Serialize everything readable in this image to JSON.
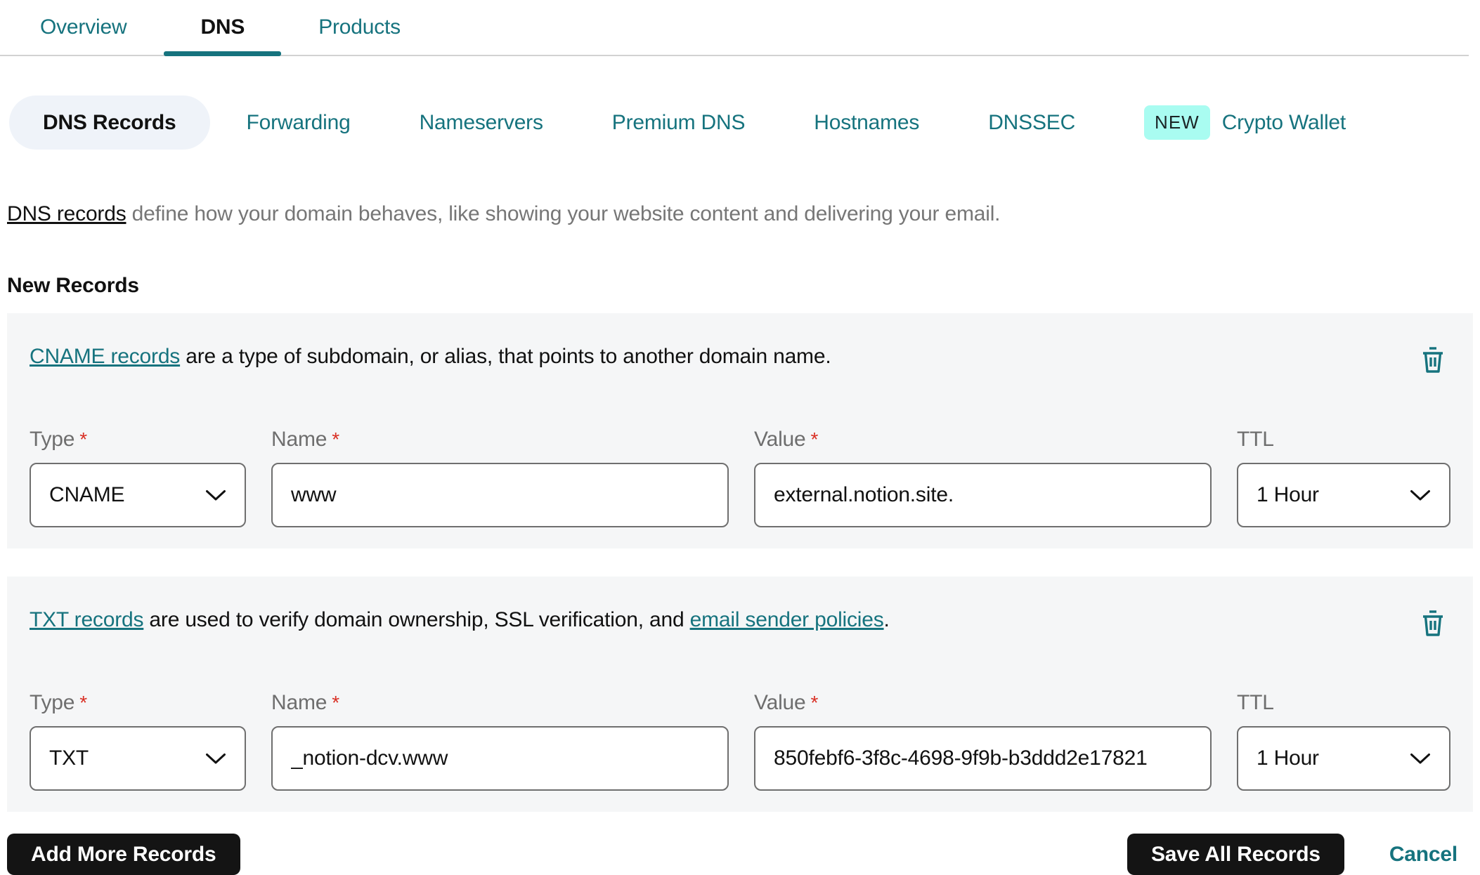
{
  "colors": {
    "teal": "#16737e",
    "badge_bg": "#a9fcf1",
    "card_bg": "#f5f6f7",
    "pill_bg": "#eff3f9",
    "required_red": "#d93025",
    "button_bg": "#141414"
  },
  "tabs": {
    "overview": "Overview",
    "dns": "DNS",
    "products": "Products"
  },
  "subtabs": {
    "dns_records": "DNS Records",
    "forwarding": "Forwarding",
    "nameservers": "Nameservers",
    "premium_dns": "Premium DNS",
    "hostnames": "Hostnames",
    "dnssec": "DNSSEC",
    "new_badge": "NEW",
    "crypto_wallet": "Crypto Wallet"
  },
  "description": {
    "link": "DNS records",
    "text": " define how your domain behaves, like showing your website content and delivering your email."
  },
  "section_title": "New Records",
  "required_marker": "*",
  "labels": {
    "type": "Type",
    "name": "Name",
    "value": "Value",
    "ttl": "TTL"
  },
  "icons": {
    "trash": "trash-icon",
    "chevron": "chevron-down-icon"
  },
  "records": [
    {
      "intro_link": "CNAME records",
      "intro_text": " are a type of subdomain, or alias, that points to another domain name.",
      "type": "CNAME",
      "name": "www",
      "value": "external.notion.site.",
      "ttl": "1 Hour"
    },
    {
      "intro_link": "TXT records",
      "intro_text": " are used to verify domain ownership, SSL verification, and ",
      "intro_link2": "email sender policies",
      "intro_suffix": ".",
      "type": "TXT",
      "name": "_notion-dcv.www",
      "value": "850febf6-3f8c-4698-9f9b-b3ddd2e17821",
      "ttl": "1 Hour"
    }
  ],
  "actions": {
    "add_more": "Add More Records",
    "save_all": "Save All Records",
    "cancel": "Cancel"
  }
}
